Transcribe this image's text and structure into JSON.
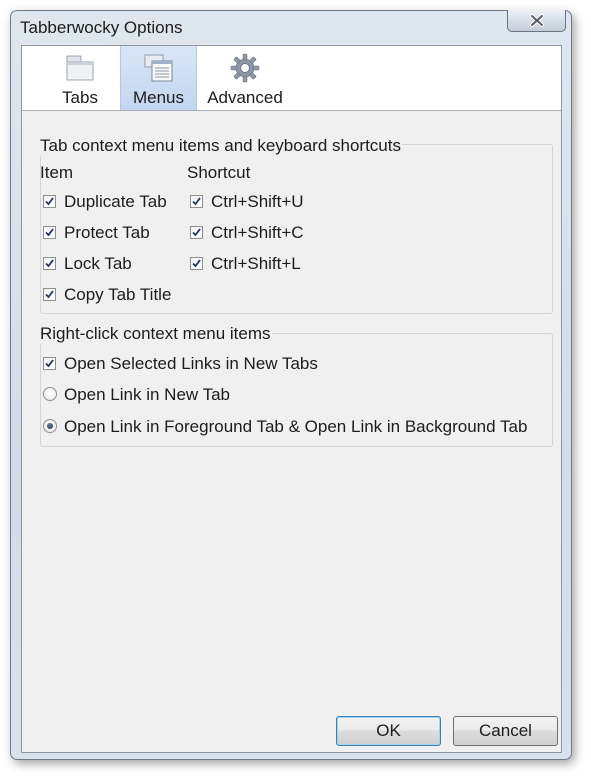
{
  "window": {
    "title": "Tabberwocky Options"
  },
  "toolbar": {
    "items": [
      {
        "label": "Tabs",
        "icon": "tabs-icon"
      },
      {
        "label": "Menus",
        "icon": "menus-icon",
        "selected": true
      },
      {
        "label": "Advanced",
        "icon": "gear-icon"
      }
    ]
  },
  "tab_context_group": {
    "title": "Tab context menu items and keyboard shortcuts",
    "item_header": "Item",
    "shortcut_header": "Shortcut",
    "rows": [
      {
        "item": "Duplicate Tab",
        "item_checked": true,
        "shortcut": "Ctrl+Shift+U",
        "shortcut_checked": true
      },
      {
        "item": "Protect Tab",
        "item_checked": true,
        "shortcut": "Ctrl+Shift+C",
        "shortcut_checked": true
      },
      {
        "item": "Lock Tab",
        "item_checked": true,
        "shortcut": "Ctrl+Shift+L",
        "shortcut_checked": true
      },
      {
        "item": "Copy Tab Title",
        "item_checked": true
      }
    ]
  },
  "right_click_group": {
    "title": "Right-click context menu items",
    "open_selected_links": {
      "label": "Open Selected Links in New Tabs",
      "checked": true
    },
    "options": [
      {
        "label": "Open Link in New Tab",
        "selected": false
      },
      {
        "label": "Open Link in Foreground Tab & Open Link in Background Tab",
        "selected": true
      }
    ]
  },
  "buttons": {
    "ok": "OK",
    "cancel": "Cancel"
  },
  "colors": {
    "selected_tool_bg": "#c3d6ef",
    "window_frame": "#d3dce6",
    "default_button_border": "#3c7fb1"
  }
}
